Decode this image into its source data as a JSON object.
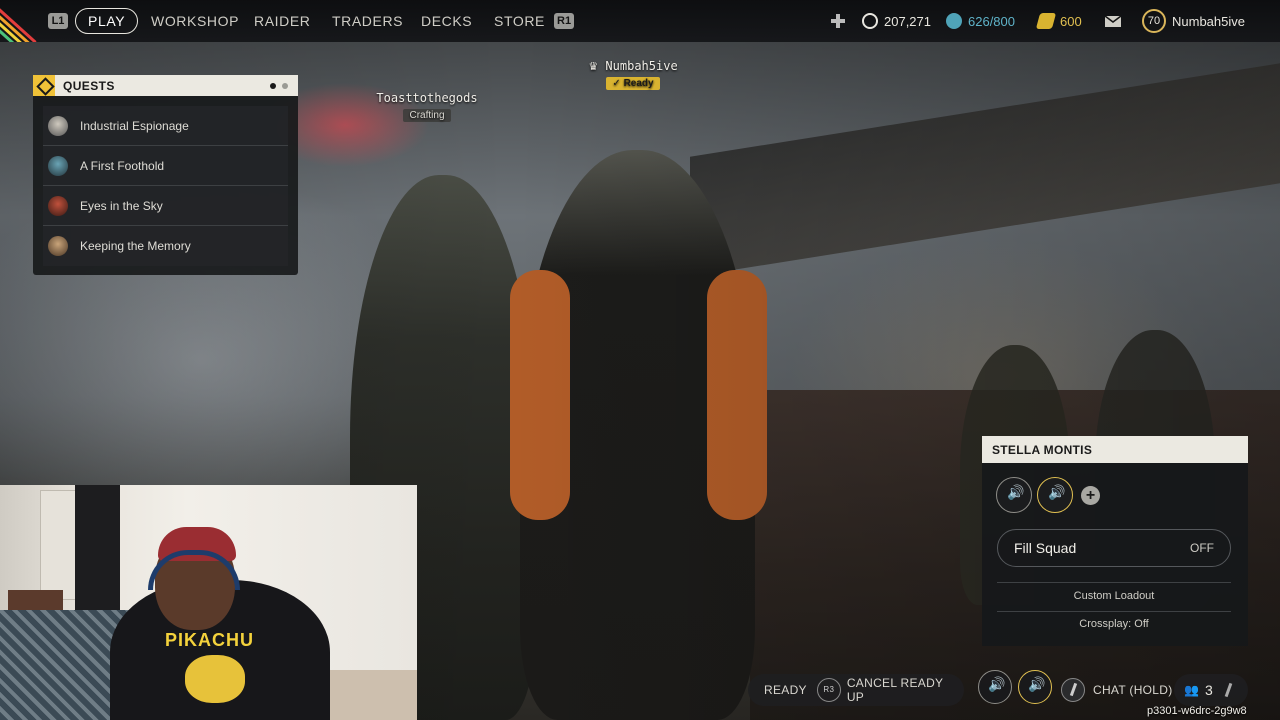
{
  "nav": {
    "left_button": "L1",
    "right_button": "R1",
    "items": [
      "PLAY",
      "WORKSHOP",
      "RAIDER",
      "TRADERS",
      "DECKS",
      "STORE"
    ],
    "active": "PLAY"
  },
  "stats": {
    "r3_label": "R3",
    "coins": "207,271",
    "stash": "626/800",
    "raider_tokens": "600",
    "level": "70",
    "username": "Numbah5ive"
  },
  "quests": {
    "title": "QUESTS",
    "items": [
      {
        "label": "Industrial Espionage",
        "icon": "quest-giver-portrait"
      },
      {
        "label": "A First Foothold",
        "icon": "quest-giver-portrait"
      },
      {
        "label": "Eyes in the Sky",
        "icon": "quest-giver-portrait"
      },
      {
        "label": "Keeping the Memory",
        "icon": "quest-giver-portrait"
      }
    ]
  },
  "players": {
    "p1": {
      "name": "Numbah5ive",
      "status": "Ready"
    },
    "p2": {
      "name": "Toasttothegods",
      "status": "Crafting"
    }
  },
  "squad": {
    "title": "STELLA MONTIS",
    "fill_label": "Fill Squad",
    "fill_value": "OFF",
    "custom_loadout": "Custom Loadout",
    "crossplay": "Crossplay: Off"
  },
  "bottom": {
    "ready": "READY",
    "r3": "R3",
    "cancel": "CANCEL READY UP",
    "chat": "CHAT (HOLD)",
    "party_count": "3",
    "session_id": "p3301-w6drc-2g9w8"
  },
  "webcam": {
    "shirt_text": "PIKACHU"
  },
  "colors": {
    "accent_yellow": "#e1c051",
    "panel_header": "#ebe9e1",
    "panel_bg": "#16181a"
  }
}
